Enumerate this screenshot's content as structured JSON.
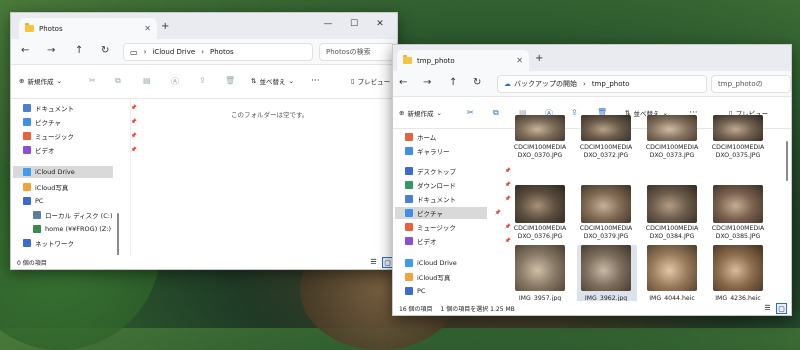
{
  "window1": {
    "tab_title": "Photos",
    "breadcrumb": [
      "iCloud Drive",
      "Photos"
    ],
    "search_placeholder": "Photosの検索",
    "toolbar": {
      "new_label": "新規作成",
      "sort_label": "並べ替え",
      "more": "···",
      "preview_label": "プレビュー"
    },
    "empty_message": "このフォルダーは空です。",
    "sidebar": [
      {
        "label": "ドキュメント",
        "icon": "documents-icon",
        "color": "#4a7fd4",
        "pinned": true
      },
      {
        "label": "ピクチャ",
        "icon": "pictures-icon",
        "color": "#3f8ee8",
        "pinned": true
      },
      {
        "label": "ミュージック",
        "icon": "music-icon",
        "color": "#e8613c",
        "pinned": true
      },
      {
        "label": "ビデオ",
        "icon": "videos-icon",
        "color": "#8a4fd6",
        "pinned": true
      },
      {
        "label": "iCloud Drive",
        "icon": "icloud-drive-icon",
        "color": "#3b9cf0",
        "selected": true
      },
      {
        "label": "iCloud写真",
        "icon": "icloud-photos-icon",
        "color": "#f2a33a"
      },
      {
        "label": "PC",
        "icon": "pc-icon",
        "color": "#3c6ad1"
      },
      {
        "label": "ローカル ディスク (C:)",
        "icon": "drive-c-icon",
        "color": "#5c7da0"
      },
      {
        "label": "home (¥¥FROG) (Z:)",
        "icon": "network-drive-icon",
        "color": "#3a8a4a"
      },
      {
        "label": "ネットワーク",
        "icon": "network-icon",
        "color": "#3c6ad1"
      }
    ],
    "status": "0 個の項目"
  },
  "window2": {
    "tab_title": "tmp_photo",
    "backup_label": "バックアップの開始",
    "breadcrumb": [
      "tmp_photo"
    ],
    "search_placeholder": "tmp_photoの",
    "toolbar": {
      "new_label": "新規作成",
      "sort_label": "並べ替え",
      "more": "···",
      "preview_label": "プレビュー"
    },
    "sidebar": [
      {
        "label": "ホーム",
        "icon": "home-icon",
        "color": "#e8613c"
      },
      {
        "label": "ギャラリー",
        "icon": "gallery-icon",
        "color": "#3f8ee8"
      },
      {
        "label": "デスクトップ",
        "icon": "desktop-icon",
        "color": "#3c6ad1",
        "pinned": true
      },
      {
        "label": "ダウンロード",
        "icon": "downloads-icon",
        "color": "#2f9a5a",
        "pinned": true
      },
      {
        "label": "ドキュメント",
        "icon": "documents-icon",
        "color": "#4a7fd4",
        "pinned": true
      },
      {
        "label": "ピクチャ",
        "icon": "pictures-icon",
        "color": "#3f8ee8",
        "pinned": true,
        "selected": true
      },
      {
        "label": "ミュージック",
        "icon": "music-icon",
        "color": "#e8613c",
        "pinned": true
      },
      {
        "label": "ビデオ",
        "icon": "videos-icon",
        "color": "#8a4fd6",
        "pinned": true
      },
      {
        "label": "iCloud Drive",
        "icon": "icloud-drive-icon",
        "color": "#3b9cf0"
      },
      {
        "label": "iCloud写真",
        "icon": "icloud-photos-icon",
        "color": "#f2a33a"
      },
      {
        "label": "PC",
        "icon": "pc-icon",
        "color": "#3c6ad1"
      }
    ],
    "files": [
      {
        "name": "CDCIM100MEDIA DXO_0370.JPG"
      },
      {
        "name": "CDCIM100MEDIA DXO_0372.JPG"
      },
      {
        "name": "CDCIM100MEDIA DXO_0373.JPG"
      },
      {
        "name": "CDCIM100MEDIA DXO_0375.JPG"
      },
      {
        "name": "CDCIM100MEDIA DXO_0376.JPG"
      },
      {
        "name": "CDCIM100MEDIA DXO_0379.JPG"
      },
      {
        "name": "CDCIM100MEDIA DXO_0384.JPG"
      },
      {
        "name": "CDCIM100MEDIA DXO_0385.JPG"
      },
      {
        "name": "IMG_3957.jpg"
      },
      {
        "name": "IMG_3962.jpg",
        "selected": true
      },
      {
        "name": "IMG_4044.heic"
      },
      {
        "name": "IMG_4236.heic"
      }
    ],
    "status_count": "16 個の項目",
    "status_selected": "1 個の項目を選択  1.25 MB"
  }
}
